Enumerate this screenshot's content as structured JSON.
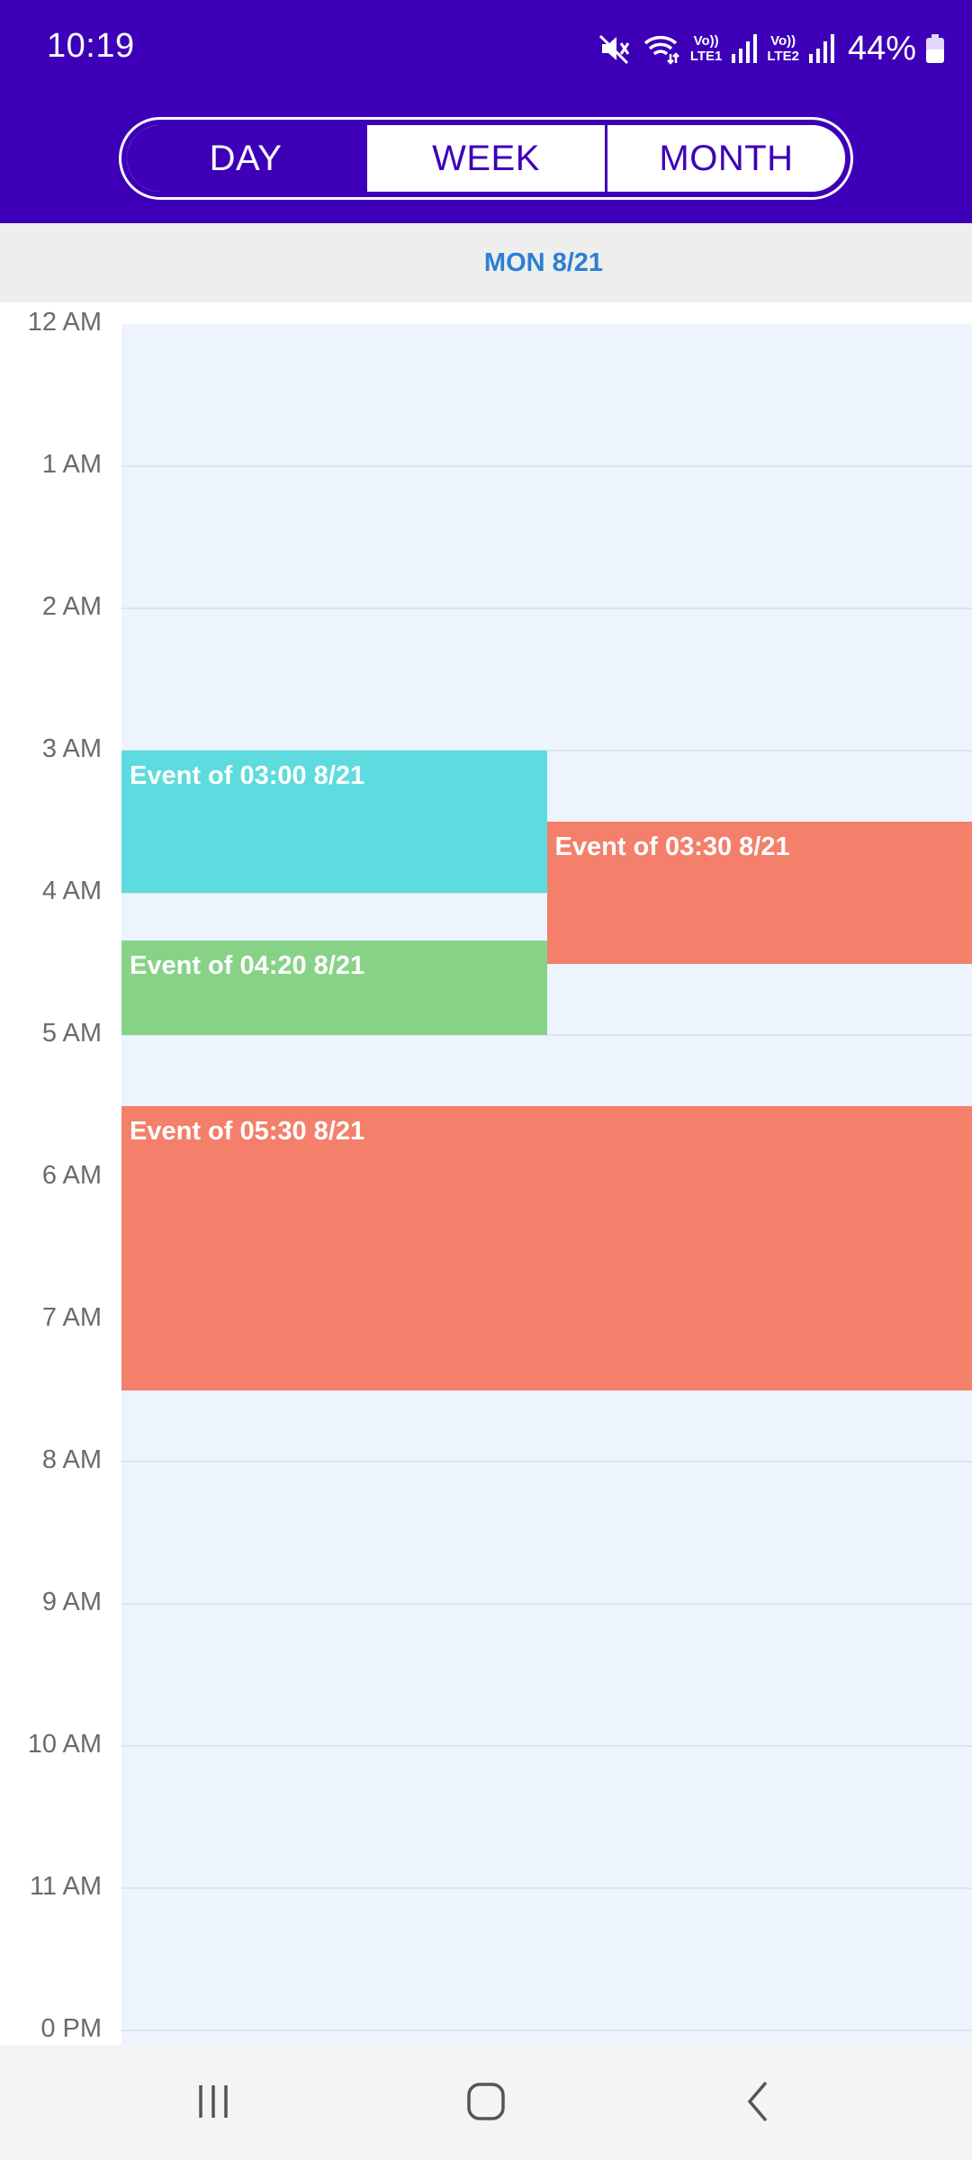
{
  "status_bar": {
    "time": "10:19",
    "lte1": [
      "Vo))",
      "LTE1"
    ],
    "lte2": [
      "Vo))",
      "LTE2"
    ],
    "battery_percent": "44%",
    "icons": [
      "mute-icon",
      "wifi-icon",
      "signal-icon",
      "signal-icon",
      "battery-icon"
    ]
  },
  "view_switcher": {
    "options": [
      "DAY",
      "WEEK",
      "MONTH"
    ],
    "selected": "DAY"
  },
  "date_header": "MON 8/21",
  "hours": [
    "12 AM",
    "1 AM",
    "2 AM",
    "3 AM",
    "4 AM",
    "5 AM",
    "6 AM",
    "7 AM",
    "8 AM",
    "9 AM",
    "10 AM",
    "11 AM",
    "0 PM"
  ],
  "events": [
    {
      "title": "Event of 03:00 8/21",
      "start": "03:00",
      "end": "04:00",
      "column": 0,
      "columns": 2,
      "color": "#5ddbde"
    },
    {
      "title": "Event of 03:30 8/21",
      "start": "03:30",
      "end": "04:30",
      "column": 1,
      "columns": 2,
      "color": "#f47f6a"
    },
    {
      "title": "Event of 04:20 8/21",
      "start": "04:20",
      "end": "05:00",
      "column": 0,
      "columns": 2,
      "color": "#88d288"
    },
    {
      "title": "Event of 05:30 8/21",
      "start": "05:30",
      "end": "07:30",
      "column": 0,
      "columns": 1,
      "color": "#f47f6a"
    }
  ],
  "nav_bar": {
    "icons": [
      "recents-icon",
      "home-icon",
      "back-icon"
    ]
  },
  "colors": {
    "accent": "#3d00b8",
    "date_text": "#2b7fd6",
    "day_background": "#eef4fd"
  }
}
